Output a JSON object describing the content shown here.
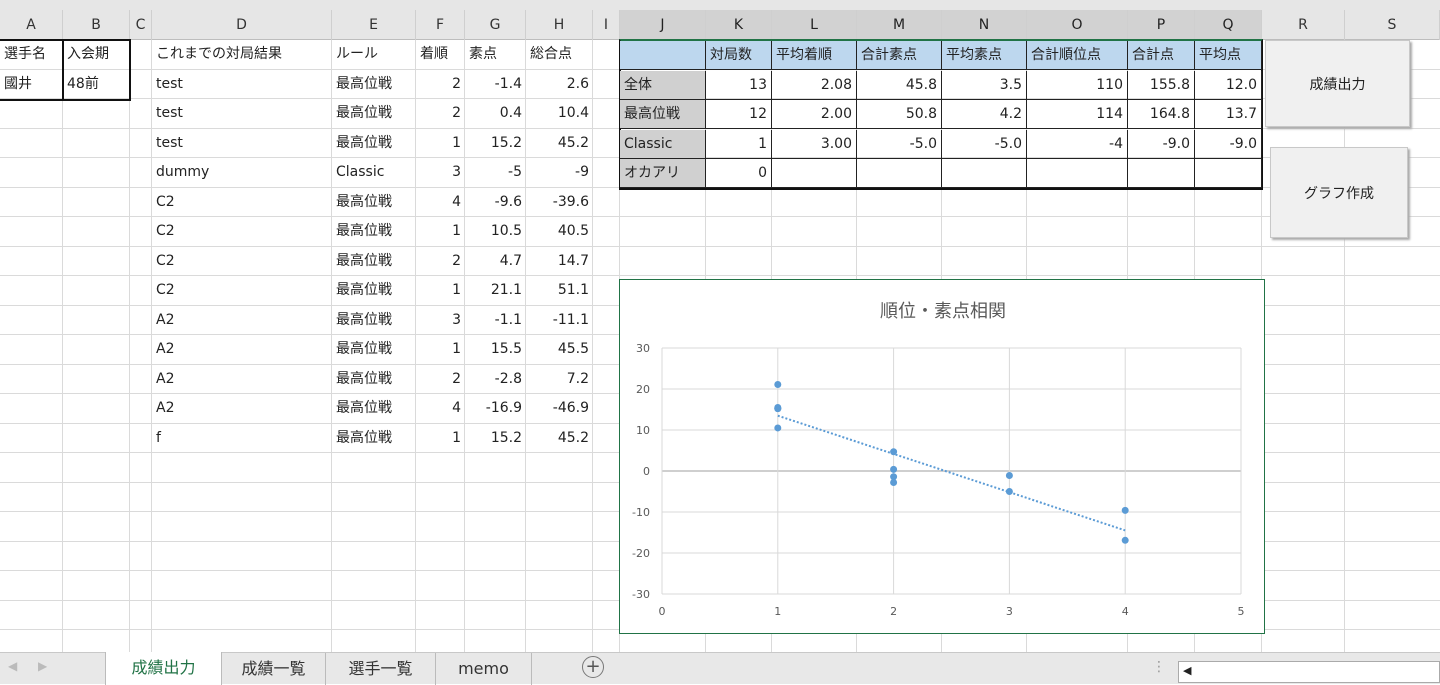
{
  "columns": [
    "A",
    "B",
    "C",
    "D",
    "E",
    "F",
    "G",
    "H",
    "I",
    "J",
    "K",
    "L",
    "M",
    "N",
    "O",
    "P",
    "Q",
    "R",
    "S"
  ],
  "player": {
    "name_header": "選手名",
    "period_header": "入会期",
    "name": "國井",
    "period": "48前"
  },
  "results": {
    "headers": [
      "これまでの対局結果",
      "ルール",
      "着順",
      "素点",
      "総合点"
    ],
    "rows": [
      [
        "test",
        "最高位戦",
        "2",
        "-1.4",
        "2.6"
      ],
      [
        "test",
        "最高位戦",
        "2",
        "0.4",
        "10.4"
      ],
      [
        "test",
        "最高位戦",
        "1",
        "15.2",
        "45.2"
      ],
      [
        "dummy",
        "Classic",
        "3",
        "-5",
        "-9"
      ],
      [
        "C2",
        "最高位戦",
        "4",
        "-9.6",
        "-39.6"
      ],
      [
        "C2",
        "最高位戦",
        "1",
        "10.5",
        "40.5"
      ],
      [
        "C2",
        "最高位戦",
        "2",
        "4.7",
        "14.7"
      ],
      [
        "C2",
        "最高位戦",
        "1",
        "21.1",
        "51.1"
      ],
      [
        "A2",
        "最高位戦",
        "3",
        "-1.1",
        "-11.1"
      ],
      [
        "A2",
        "最高位戦",
        "1",
        "15.5",
        "45.5"
      ],
      [
        "A2",
        "最高位戦",
        "2",
        "-2.8",
        "7.2"
      ],
      [
        "A2",
        "最高位戦",
        "4",
        "-16.9",
        "-46.9"
      ],
      [
        "f",
        "最高位戦",
        "1",
        "15.2",
        "45.2"
      ]
    ]
  },
  "summary": {
    "headers": [
      "",
      "対局数",
      "平均着順",
      "合計素点",
      "平均素点",
      "合計順位点",
      "合計点",
      "平均点"
    ],
    "rows": [
      [
        "全体",
        "13",
        "2.08",
        "45.8",
        "3.5",
        "110",
        "155.8",
        "12.0"
      ],
      [
        "最高位戦",
        "12",
        "2.00",
        "50.8",
        "4.2",
        "114",
        "164.8",
        "13.7"
      ],
      [
        "Classic",
        "1",
        "3.00",
        "-5.0",
        "-5.0",
        "-4",
        "-9.0",
        "-9.0"
      ],
      [
        "オカアリ",
        "0",
        "",
        "",
        "",
        "",
        "",
        ""
      ]
    ]
  },
  "buttons": {
    "output": "成績出力",
    "graph": "グラフ作成"
  },
  "chart_data": {
    "type": "scatter",
    "title": "順位・素点相関",
    "xlim": [
      0,
      5
    ],
    "ylim": [
      -30,
      30
    ],
    "xticks": [
      "0",
      "1",
      "2",
      "3",
      "4",
      "5"
    ],
    "yticks": [
      "30",
      "20",
      "10",
      "0",
      "-10",
      "-20",
      "-30"
    ],
    "points": [
      [
        2,
        -1.4
      ],
      [
        2,
        0.4
      ],
      [
        1,
        15.2
      ],
      [
        3,
        -5
      ],
      [
        4,
        -9.6
      ],
      [
        1,
        10.5
      ],
      [
        2,
        4.7
      ],
      [
        1,
        21.1
      ],
      [
        3,
        -1.1
      ],
      [
        1,
        15.5
      ],
      [
        2,
        -2.8
      ],
      [
        4,
        -16.9
      ],
      [
        1,
        15.2
      ]
    ],
    "trendline": {
      "type": "linear",
      "from": [
        1,
        13.5
      ],
      "to": [
        4,
        -14.5
      ]
    },
    "color": "#5b9bd5"
  },
  "tabs": [
    "成績出力",
    "成績一覧",
    "選手一覧",
    "memo"
  ],
  "active_tab": 0
}
